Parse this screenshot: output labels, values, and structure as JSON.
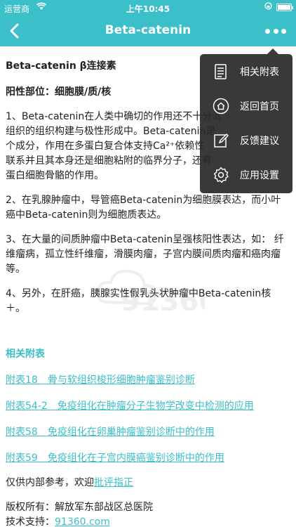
{
  "status_bar": {
    "carrier": "运营商",
    "time": "上午10:45"
  },
  "nav": {
    "title": "Beta-catenin"
  },
  "article": {
    "heading": "Beta-catenin β连接素",
    "site": "阳性部位：细胞膜/质/核",
    "p1": "1、Beta-catenin在人类中确切的作用还不十分清楚，但它与细胞黏附和维持组织的组织构建与极性形成中。Beta-catenin是连接E-cadherin与α-catenin的一个成分，作用在多蛋白复合体支持Ca²⁺依赖性黏附。在细胞间、细胞膜间都有联系并且其本身还是细胞粘附的临界分子，还有一个与细胞间连接有关的蛋白质－白细胞骨骼的作用。",
    "p1_lines": [
      "1、Beta-catenin在人类中确切的作用还不十分清",
      "组织的组织构建与极性形成中。Beta-catenin是",
      "个成分，作用在多蛋白复合体支持Ca²⁺依赖性",
      "联系并且其本身还是细胞粘附的临界分子，还有",
      "蛋白细胞骨骼的作用。"
    ],
    "p2": "2、在乳腺肿瘤中，导管癌Beta-catenin为细胞膜表达，而小叶癌中Beta-catenin则为细胞质表达。",
    "p3": "3、在大量的间质肿瘤中Beta-catenin呈强核阳性表达，如： 纤维瘤病，孤立性纤维瘤，滑膜肉瘤，子宫内膜间质肉瘤和癌肉瘤等。",
    "p4": "4、另外，在肝癌，胰腺实性假乳头状肿瘤中Beta-catenin核＋。"
  },
  "related": {
    "title": "相关附表",
    "links": [
      "附表18　骨与软组织梭形细胞肿瘤鉴别诊断",
      "附表54-2　免疫组化在肿瘤分子生物学改变中检测的应用",
      "附表58　免疫组化在卵巢肿瘤鉴别诊断中的作用",
      "附表59　免疫组化在子宫内膜癌鉴别诊断中的作用"
    ]
  },
  "footer": {
    "note_prefix": "仅供内部参考，欢迎",
    "note_link": "批评指正",
    "copyright": "版权所有：解放军东部战区总医院",
    "support_prefix": "技术支持：",
    "support_link": "91360.com"
  },
  "watermark": "91360.com",
  "menu": {
    "items": [
      {
        "label": "相关附表",
        "icon": "document-icon"
      },
      {
        "label": "返回首页",
        "icon": "home-icon"
      },
      {
        "label": "反馈建议",
        "icon": "edit-icon"
      },
      {
        "label": "应用设置",
        "icon": "gear-icon"
      }
    ]
  },
  "colors": {
    "accent": "#3bbfc8",
    "menu_bg": "#282828"
  }
}
